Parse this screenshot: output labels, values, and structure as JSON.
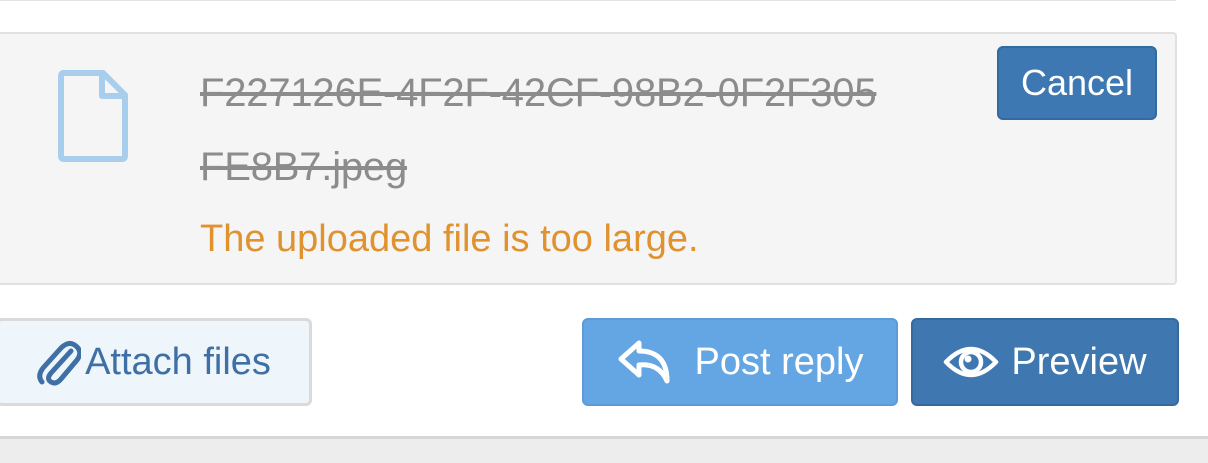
{
  "upload": {
    "file_name": "F227126E-4F2F-42CF-98B2-0F2F305FE8B7.jpeg",
    "error_message": "The uploaded file is too large.",
    "cancel_label": "Cancel",
    "file_icon": "file-icon"
  },
  "actions": {
    "attach_label": "Attach files",
    "attach_icon": "paperclip-icon",
    "post_reply_label": "Post reply",
    "post_reply_icon": "reply-icon",
    "preview_label": "Preview",
    "preview_icon": "eye-icon"
  },
  "colors": {
    "error": "#e0922f",
    "primary": "#3f77b0",
    "primary_light": "#64a6e3",
    "muted_text": "#8c8c8c"
  }
}
